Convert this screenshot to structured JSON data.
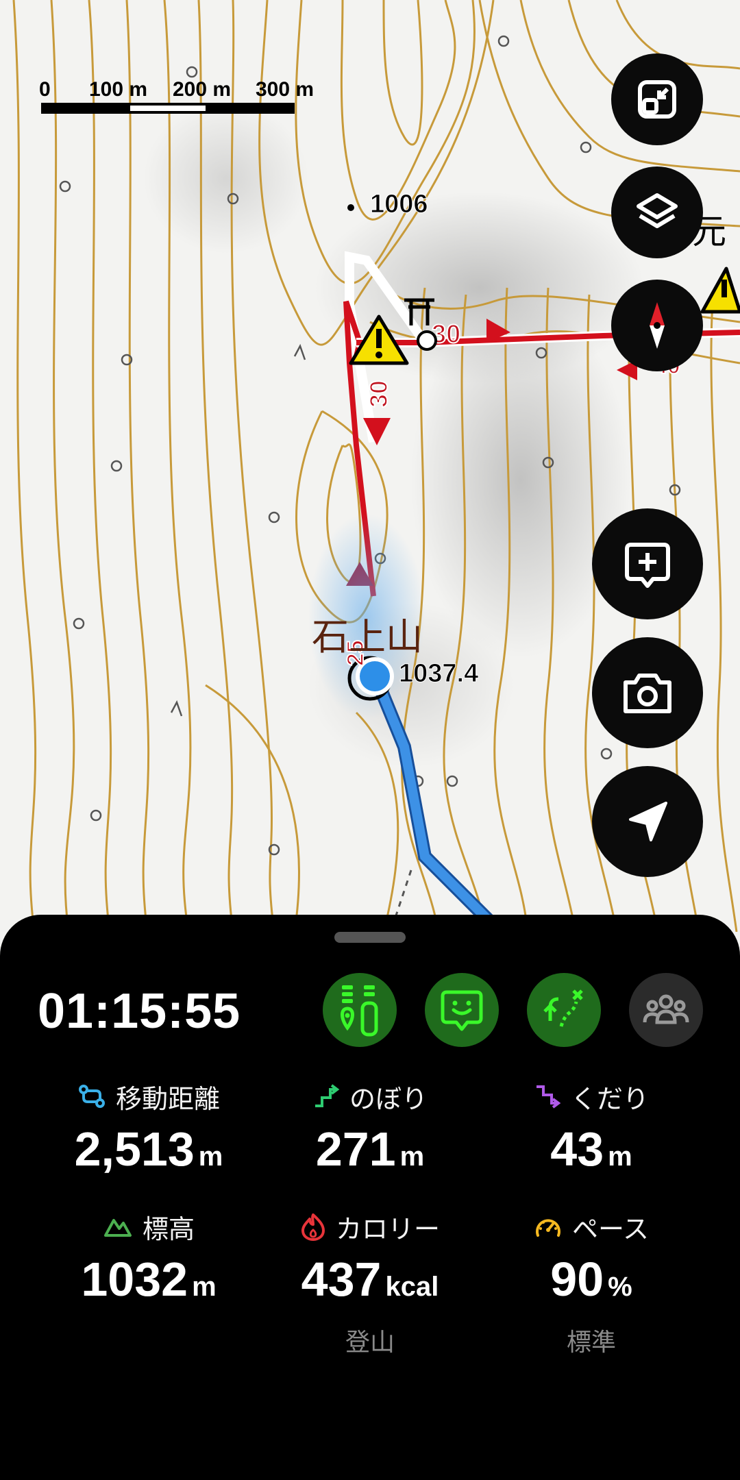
{
  "map": {
    "scale_labels": [
      "0",
      "100 m",
      "200 m",
      "300 m"
    ],
    "peak_label": "1006",
    "current_elevation": "1037.4",
    "mountain_name": "石上山",
    "right_label": "元",
    "route_marks": {
      "a": "30",
      "b": "30",
      "c": "25",
      "d": "40"
    },
    "colors": {
      "planned_route": "#d3101d",
      "track": "#3d91e6",
      "contour": "#c79a3a"
    }
  },
  "fab": {
    "icons": [
      "fullscreen-exit-icon",
      "layers-icon",
      "compass-icon",
      "add-note-icon",
      "camera-icon",
      "navigation-icon"
    ]
  },
  "sheet": {
    "timer": "01:15:55",
    "quick_buttons": [
      "trail-info-icon",
      "chat-icon",
      "route-icon",
      "group-icon"
    ],
    "stats": {
      "distance": {
        "label": "移動距離",
        "value": "2,513",
        "unit": "m"
      },
      "ascent": {
        "label": "のぼり",
        "value": "271",
        "unit": "m"
      },
      "descent": {
        "label": "くだり",
        "value": "43",
        "unit": "m"
      },
      "altitude": {
        "label": "標高",
        "value": "1032",
        "unit": "m"
      },
      "calories": {
        "label": "カロリー",
        "value": "437",
        "unit": "kcal",
        "sub": "登山"
      },
      "pace": {
        "label": "ペース",
        "value": "90",
        "unit": "%",
        "sub": "標準"
      }
    }
  }
}
